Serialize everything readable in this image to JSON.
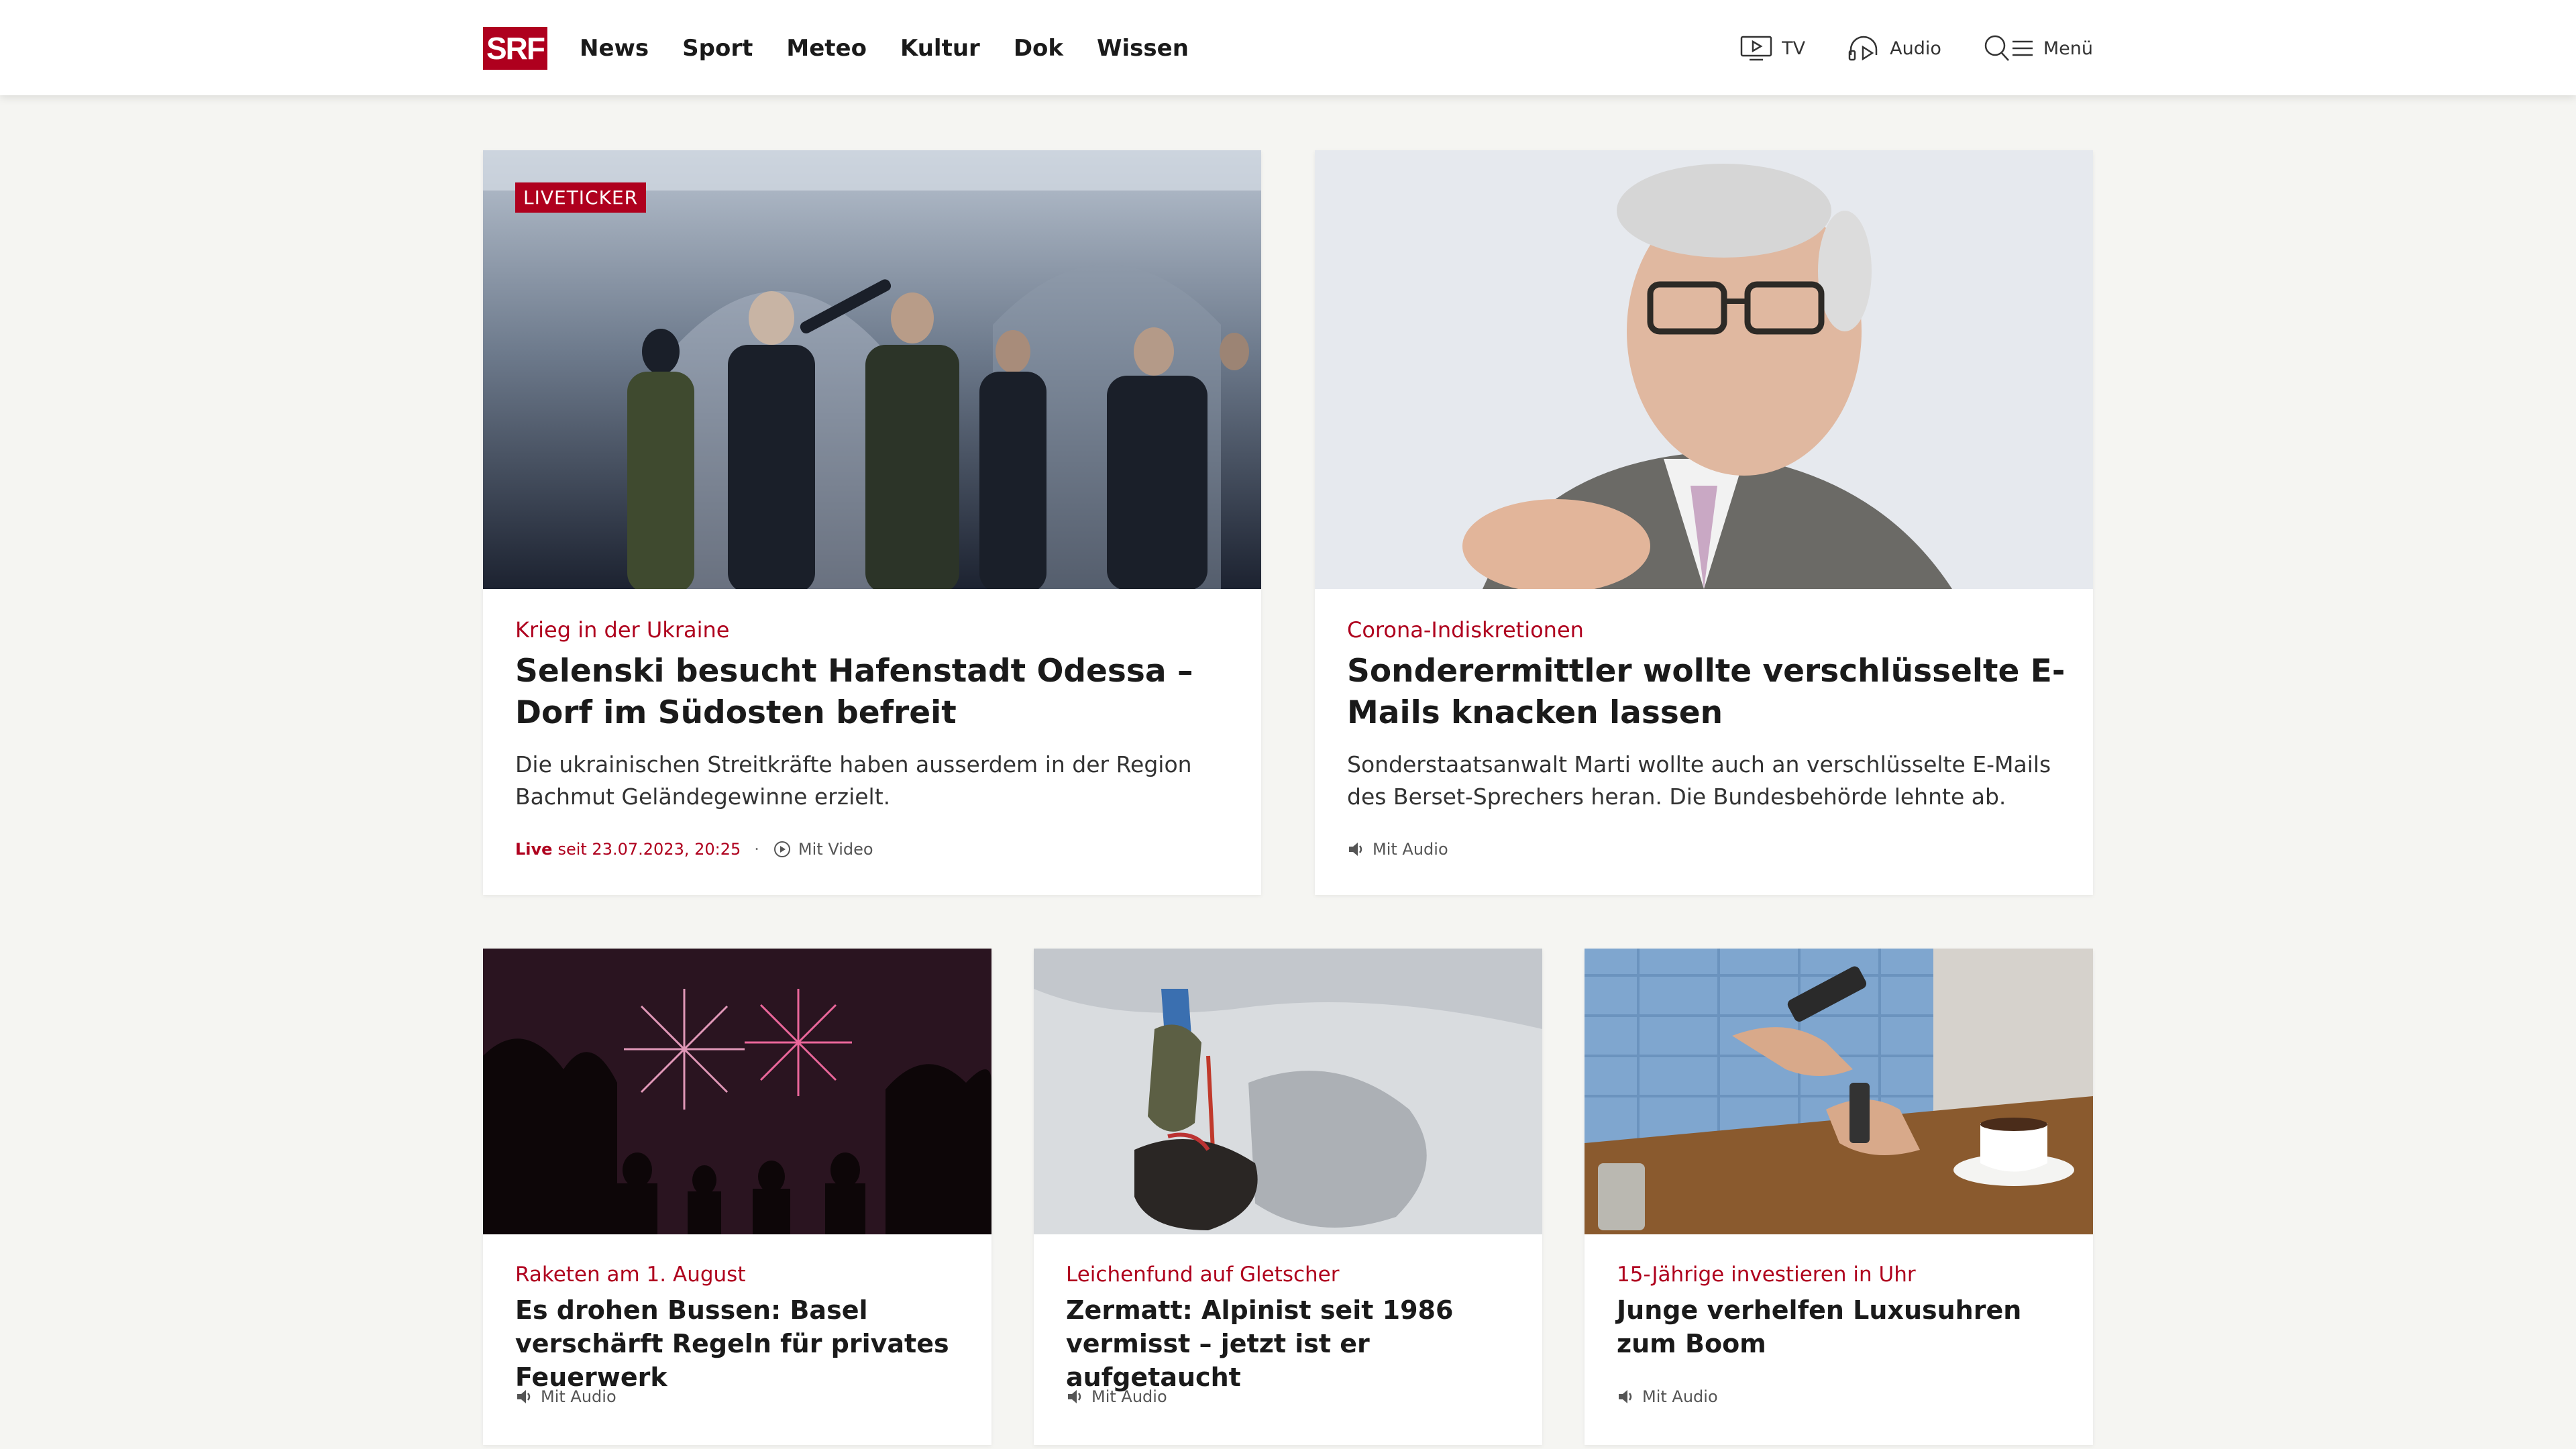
{
  "header": {
    "logo": "SRF",
    "nav": [
      "News",
      "Sport",
      "Meteo",
      "Kultur",
      "Dok",
      "Wissen"
    ],
    "tv_label": "TV",
    "audio_label": "Audio",
    "menu_label": "Menü"
  },
  "colors": {
    "brand": "#af001e",
    "background": "#f5f5f2"
  },
  "cards": [
    {
      "badge": "LIVETICKER",
      "kicker": "Krieg in der Ukraine",
      "title": "Selenski besucht Hafenstadt Odessa – Dorf im Südosten befreit",
      "lead": "Die ukrainischen Streitkräfte haben ausserdem in der Region Bachmut Geländegewinne erzielt.",
      "meta_live": "Live",
      "meta_since": "seit 23.07.2023, 20:25",
      "meta_sep": "·",
      "meta_media": "Mit Video",
      "image": "Soldiers and officials with Zelensky inside a damaged cathedral"
    },
    {
      "kicker": "Corona-Indiskretionen",
      "title": "Sonderermittler wollte verschlüsselte E-Mails knacken lassen",
      "lead": "Sonderstaatsanwalt Marti wollte auch an verschlüsselte E-Mails des Berset-Sprechers heran. Die Bundesbehörde lehnte ab.",
      "meta_media": "Mit Audio",
      "image": "Grey-haired man with glasses gesturing"
    },
    {
      "kicker": "Raketen am 1. August",
      "title": "Es drohen Bussen: Basel verschärft Regeln für privates Feuerwerk",
      "meta_media": "Mit Audio",
      "image": "Fireworks at night with silhouettes of spectators"
    },
    {
      "kicker": "Leichenfund auf Gletscher",
      "title": "Zermatt: Alpinist seit 1986 vermisst – jetzt ist er aufgetaucht",
      "meta_media": "Mit Audio",
      "image": "Climbing gear and boot on glacier ice"
    },
    {
      "kicker": "15-Jährige investieren in Uhr",
      "title": "Junge verhelfen Luxusuhren zum Boom",
      "meta_media": "Mit Audio",
      "image": "Man with phone and wristwatch at a café table"
    }
  ]
}
